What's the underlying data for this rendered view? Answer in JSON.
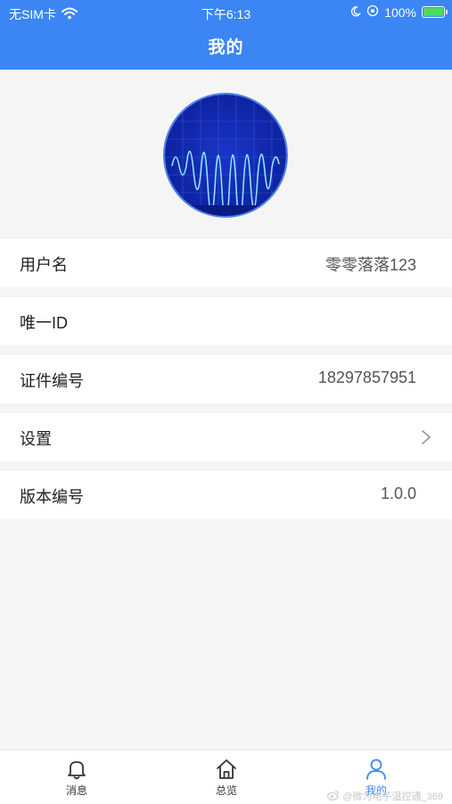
{
  "status_bar": {
    "carrier": "无SIM卡",
    "time": "下午6:13",
    "battery": "100%",
    "battery_level": 1.0
  },
  "header": {
    "title": "我的"
  },
  "profile": {
    "rows": [
      {
        "label": "用户名",
        "value": "零零落落123"
      },
      {
        "label": "唯一ID",
        "value": ""
      },
      {
        "label": "证件编号",
        "value": "18297857951"
      },
      {
        "label": "设置",
        "value": ""
      },
      {
        "label": "版本编号",
        "value": "1.0.0"
      }
    ]
  },
  "tabbar": {
    "items": [
      {
        "label": "消息",
        "icon": "bell-icon",
        "active": false
      },
      {
        "label": "总览",
        "icon": "home-icon",
        "active": false
      },
      {
        "label": "我的",
        "icon": "user-icon",
        "active": true
      }
    ]
  },
  "watermark": {
    "text": "@微为电子温控通_369"
  },
  "colors": {
    "accent": "#3b86f4",
    "background": "#f5f5f5"
  }
}
